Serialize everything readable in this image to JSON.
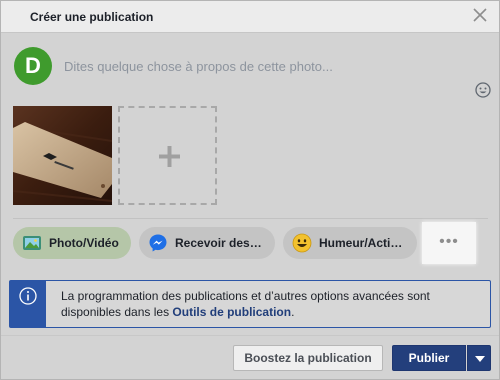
{
  "dialog": {
    "title": "Créer une publication"
  },
  "composer": {
    "avatar_letter": "D",
    "placeholder": "Dites quelque chose à propos de cette photo..."
  },
  "actions": [
    {
      "label": "Photo/Vidéo",
      "icon": "photo-icon"
    },
    {
      "label": "Recevoir des…",
      "icon": "messenger-icon"
    },
    {
      "label": "Humeur/Acti…",
      "icon": "emoji-icon"
    },
    {
      "label": "•••",
      "icon": "more-options-icon"
    }
  ],
  "info_box": {
    "text_before": "La programmation des publications et d’autres options avancées sont disponibles dans les ",
    "link": "Outils de publication",
    "text_after": "."
  },
  "footer": {
    "boost_label": "Boostez la publication",
    "publish_label": "Publier"
  },
  "colors": {
    "primary": "#233f7c",
    "info_accent": "#2b55a6",
    "avatar": "#3f9b2d"
  }
}
